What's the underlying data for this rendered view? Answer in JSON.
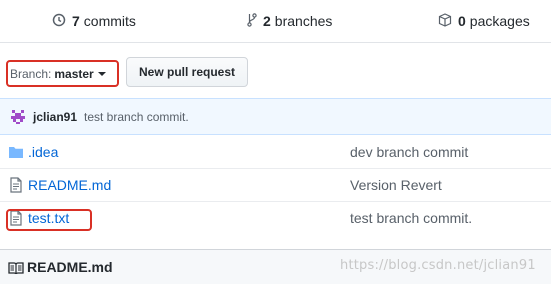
{
  "stats": {
    "commits": {
      "count": "7",
      "label": "commits",
      "icon": "history-icon"
    },
    "branches": {
      "count": "2",
      "label": "branches",
      "icon": "git-branch-icon"
    },
    "packages": {
      "count": "0",
      "label": "packages",
      "icon": "package-icon"
    }
  },
  "branch_select": {
    "label": "Branch:",
    "value": "master"
  },
  "toolbar": {
    "new_pr_label": "New pull request"
  },
  "latest_commit": {
    "author": "jclian91",
    "message": "test branch commit."
  },
  "files": [
    {
      "name": ".idea",
      "type": "directory",
      "icon": "folder-icon",
      "message": "dev branch commit"
    },
    {
      "name": "README.md",
      "type": "file",
      "icon": "file-icon",
      "message": "Version Revert"
    },
    {
      "name": "test.txt",
      "type": "file",
      "icon": "file-icon",
      "message": "test branch commit."
    }
  ],
  "readme": {
    "title": "README.md",
    "icon": "book-icon"
  },
  "watermark": "https://blog.csdn.net/jclian91",
  "colors": {
    "link": "#0366d6",
    "highlight": "#d93025",
    "commit_bg": "#f1f8ff",
    "avatar": "#8e44ad"
  }
}
